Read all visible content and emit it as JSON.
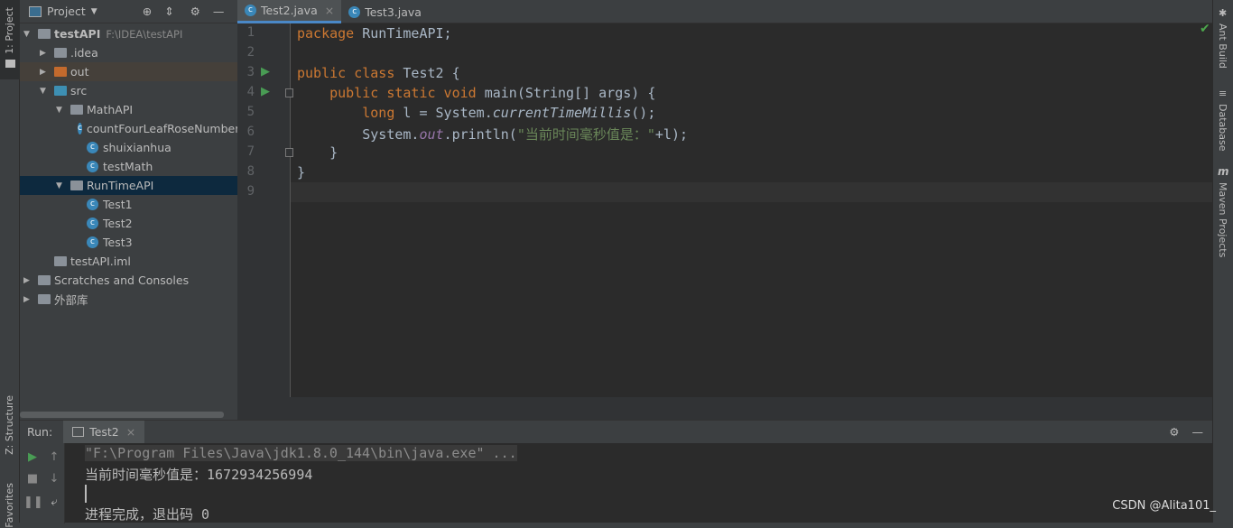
{
  "left_strip": {
    "project": "1: Project",
    "structure": "Z: Structure",
    "favorites": "Favorites"
  },
  "right_strip": {
    "ant": "Ant Build",
    "database": "Database",
    "maven": "Maven Projects"
  },
  "project_panel": {
    "title": "Project",
    "tree": [
      {
        "label": "testAPI",
        "path": "F:\\IDEA\\testAPI",
        "type": "module",
        "expanded": true
      },
      {
        "label": ".idea",
        "type": "folder"
      },
      {
        "label": "out",
        "type": "folder-excluded"
      },
      {
        "label": "src",
        "type": "source",
        "expanded": true
      },
      {
        "label": "MathAPI",
        "type": "package",
        "expanded": true
      },
      {
        "label": "countFourLeafRoseNumber",
        "type": "class"
      },
      {
        "label": "shuixianhua",
        "type": "class"
      },
      {
        "label": "testMath",
        "type": "class"
      },
      {
        "label": "RunTimeAPI",
        "type": "package",
        "expanded": true,
        "selected": true
      },
      {
        "label": "Test1",
        "type": "class"
      },
      {
        "label": "Test2",
        "type": "class"
      },
      {
        "label": "Test3",
        "type": "class"
      },
      {
        "label": "testAPI.iml",
        "type": "file"
      },
      {
        "label": "Scratches and Consoles",
        "type": "scratches"
      },
      {
        "label": "外部库",
        "type": "libraries"
      }
    ]
  },
  "editor": {
    "tabs": [
      {
        "label": "Test2.java",
        "active": true
      },
      {
        "label": "Test3.java",
        "active": false
      }
    ],
    "line_numbers": [
      "1",
      "2",
      "3",
      "4",
      "5",
      "6",
      "7",
      "8",
      "9"
    ],
    "code": {
      "l1a": "package",
      "l1b": " RunTimeAPI;",
      "l3a": "public class",
      "l3b": " Test2 {",
      "l4a": "    public static void",
      "l4b": " main(String[] args) {",
      "l5a": "        long",
      "l5b": " l = System.",
      "l5c": "currentTimeMillis",
      "l5d": "();",
      "l6a": "        System.",
      "l6b": "out",
      "l6c": ".println(",
      "l6d": "\"当前时间毫秒值是：\"",
      "l6e": "+l);",
      "l7": "    }",
      "l8": "}"
    }
  },
  "run_panel": {
    "label": "Run:",
    "tab": "Test2",
    "lines": [
      "\"F:\\Program Files\\Java\\jdk1.8.0_144\\bin\\java.exe\" ...",
      "当前时间毫秒值是：1672934256994",
      "",
      "进程完成，退出码 0"
    ]
  },
  "watermark": "CSDN @Alita101_"
}
